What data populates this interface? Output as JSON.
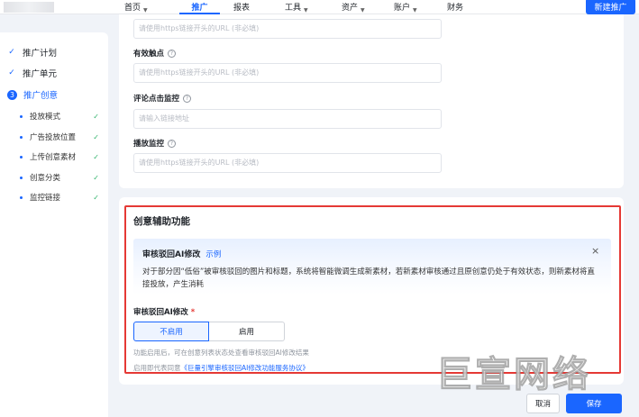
{
  "nav": {
    "items": [
      {
        "label": "首页",
        "caret": true
      },
      {
        "label": "推广",
        "caret": false,
        "active": true
      },
      {
        "label": "报表",
        "caret": false
      },
      {
        "label": "工具",
        "caret": true
      },
      {
        "label": "资产",
        "caret": true
      },
      {
        "label": "账户",
        "caret": true
      },
      {
        "label": "财务",
        "caret": false
      }
    ],
    "new_button": "新建推广"
  },
  "sidebar": {
    "steps": [
      {
        "label": "推广计划",
        "state": "done"
      },
      {
        "label": "推广单元",
        "state": "done"
      },
      {
        "label": "推广创意",
        "state": "current",
        "num": "3"
      }
    ],
    "substeps": [
      {
        "label": "投放模式"
      },
      {
        "label": "广告投放位置"
      },
      {
        "label": "上传创意素材"
      },
      {
        "label": "创意分类"
      },
      {
        "label": "监控链接"
      }
    ]
  },
  "form": {
    "first_input_placeholder": "请使用https链接开头的URL (非必填)",
    "fields": [
      {
        "label": "有效触点",
        "placeholder": "请使用https链接开头的URL (非必填)"
      },
      {
        "label": "评论点击监控",
        "placeholder": "请输入链接地址"
      },
      {
        "label": "播放监控",
        "placeholder": "请使用https链接开头的URL (非必填)"
      }
    ]
  },
  "assist": {
    "title": "创意辅助功能",
    "tip": {
      "title": "审核驳回AI修改",
      "link": "示例",
      "close": "×",
      "text": "对于部分因“低俗”被审核驳回的图片和标题，系统将智能微调生成新素材，若新素材审核通过且原创意仍处于有效状态，则新素材将直接投放，产生消耗"
    },
    "ai_label": "审核驳回AI修改",
    "required_mark": "*",
    "options": [
      "不启用",
      "启用"
    ],
    "selected": "不启用",
    "hint": "功能启用后，可在创意列表状态处查看审核驳回AI修改结果",
    "agree_prefix": "启用即代表同意",
    "agree_link": "《巨量引擎审核驳回AI修改功能服务协议》"
  },
  "footer": {
    "cancel": "取消",
    "save": "保存"
  },
  "watermark": "巨宣网络",
  "colors": {
    "primary": "#1a66ff",
    "highlight_frame": "#e53935",
    "success": "#32b36c"
  }
}
